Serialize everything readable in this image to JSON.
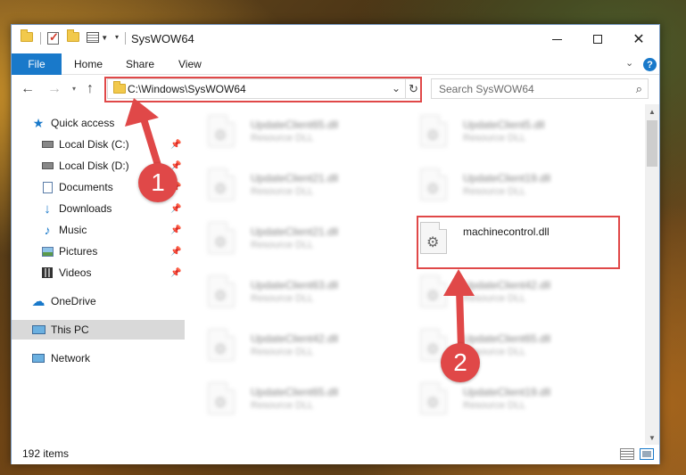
{
  "window": {
    "title": "SysWOW64"
  },
  "ribbon": {
    "tabs": [
      "File",
      "Home",
      "Share",
      "View"
    ]
  },
  "nav": {
    "address": "C:\\Windows\\SysWOW64",
    "search_placeholder": "Search SysWOW64"
  },
  "sidebar": {
    "quick_access": "Quick access",
    "items": [
      {
        "label": "Local Disk (C:)",
        "icon": "drive-icon"
      },
      {
        "label": "Local Disk (D:)",
        "icon": "drive-icon"
      },
      {
        "label": "Documents",
        "icon": "documents-icon"
      },
      {
        "label": "Downloads",
        "icon": "downloads-icon"
      },
      {
        "label": "Music",
        "icon": "music-icon"
      },
      {
        "label": "Pictures",
        "icon": "pictures-icon"
      },
      {
        "label": "Videos",
        "icon": "videos-icon"
      }
    ],
    "onedrive": "OneDrive",
    "this_pc": "This PC",
    "network": "Network"
  },
  "files": {
    "left": [
      {
        "name": "UpdateClient65.dll",
        "type": "Resource DLL"
      },
      {
        "name": "UpdateClient21.dll",
        "type": "Resource DLL"
      },
      {
        "name": "UpdateClient21.dll",
        "type": "Resource DLL"
      },
      {
        "name": "UpdateClient63.dll",
        "type": "Resource DLL"
      },
      {
        "name": "UpdateClient42.dll",
        "type": "Resource DLL"
      },
      {
        "name": "UpdateClient65.dll",
        "type": "Resource DLL"
      }
    ],
    "right": [
      {
        "name": "UpdateClient5.dll",
        "type": "Resource DLL"
      },
      {
        "name": "UpdateClient19.dll",
        "type": "Resource DLL"
      },
      {
        "name": "machinecontrol.dll",
        "type": ""
      },
      {
        "name": "UpdateClient42.dll",
        "type": "Resource DLL"
      },
      {
        "name": "UpdateClient65.dll",
        "type": "Resource DLL"
      },
      {
        "name": "UpdateClient19.dll",
        "type": "Resource DLL"
      }
    ]
  },
  "status": {
    "item_count": "192 items"
  },
  "annotations": {
    "step1": "1",
    "step2": "2",
    "color": "#e04848"
  }
}
